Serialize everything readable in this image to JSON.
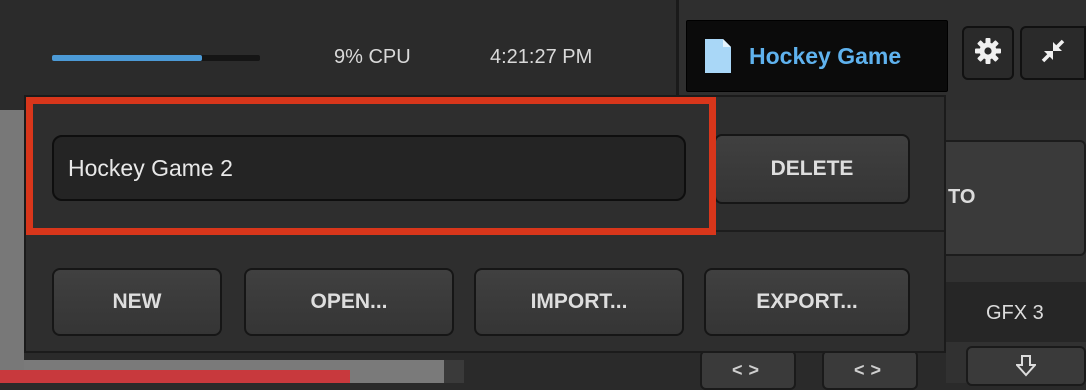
{
  "status_bar": {
    "cpu_usage_fraction": 0.72,
    "cpu_text": "9% CPU",
    "clock": "4:21:27 PM"
  },
  "header": {
    "file_title": "Hockey Game",
    "file_icon": "document-icon",
    "settings_icon": "gear-icon",
    "fullscreen_icon": "collapse-arrows-icon"
  },
  "file_menu": {
    "name_input_value": "Hockey Game 2",
    "delete_label": "DELETE",
    "new_label": "NEW",
    "open_label": "OPEN...",
    "import_label": "IMPORT...",
    "export_label": "EXPORT..."
  },
  "background": {
    "partial_button_label": "TO",
    "gfx_label": "GFX 3",
    "swap_glyph": "<>"
  },
  "colors": {
    "accent_blue": "#5fb2ee",
    "highlight_red": "#d8361b",
    "cpu_bar": "#4c9ad6"
  }
}
